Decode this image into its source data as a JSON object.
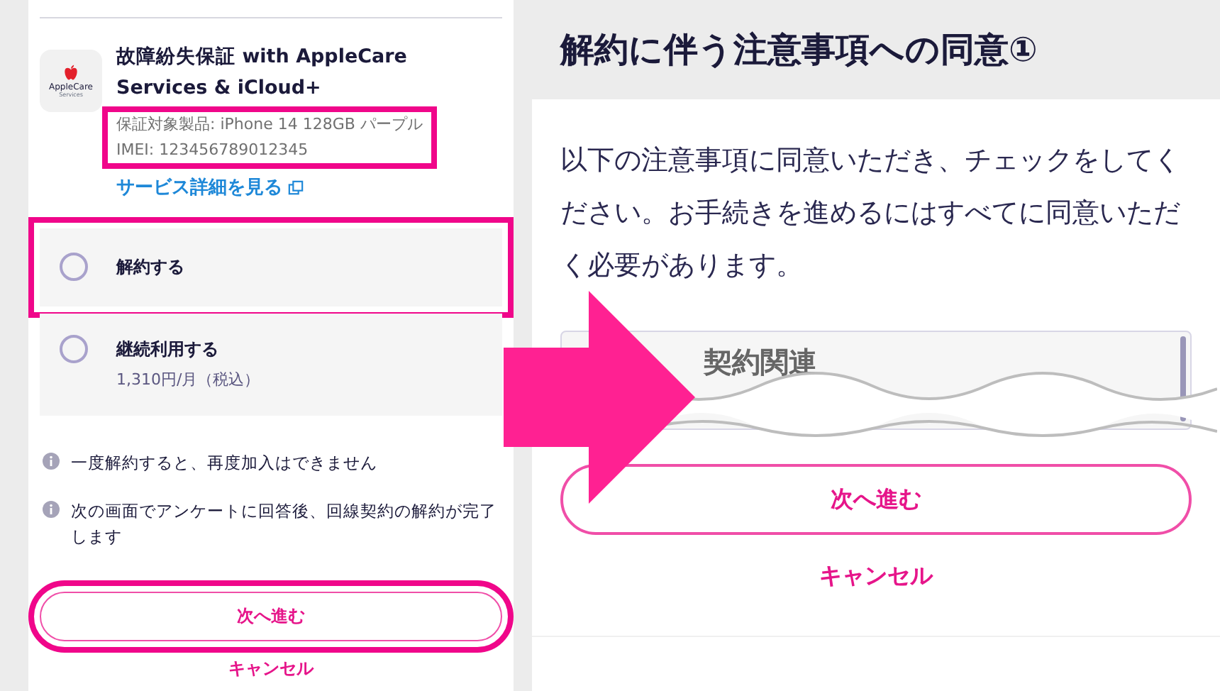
{
  "left": {
    "product": {
      "title": "故障紛失保証 with AppleCare Services & iCloud+",
      "icon_caption": "AppleCare",
      "icon_subcaption": "Services",
      "details": [
        "保証対象製品: iPhone 14 128GB パープル",
        "IMEI: 123456789012345"
      ],
      "details_highlighted": true,
      "link": "サービス詳細を見る"
    },
    "options": [
      {
        "label": "解約する",
        "selected": false,
        "highlighted": true
      },
      {
        "label": "継続利用する",
        "price": "1,310円/月（税込）",
        "selected": false,
        "highlighted": false
      }
    ],
    "notes": [
      "一度解約すると、再度加入はできません",
      "次の画面でアンケートに回答後、回線契約の解約が完了します"
    ],
    "next_button": {
      "label": "次へ進む",
      "highlighted": true
    },
    "cancel_link": "キャンセル"
  },
  "right": {
    "title": "解約に伴う注意事項への同意①",
    "intro": "以下の注意事項に同意いただき、チェックをしてください。お手続きを進めるにはすべてに同意いただく必要があります。",
    "section_title": "契約関連",
    "next_button": "次へ進む",
    "cancel_link": "キャンセル"
  }
}
